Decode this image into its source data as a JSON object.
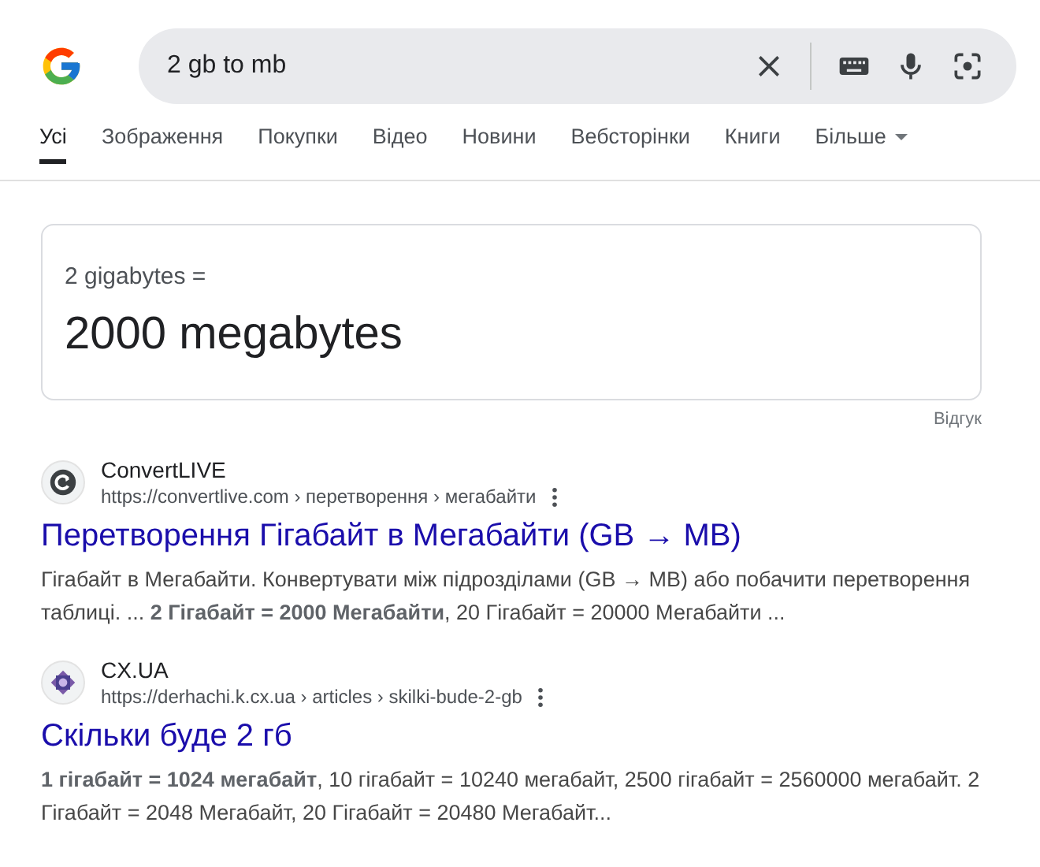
{
  "search": {
    "value": "2 gb to mb"
  },
  "tabs": [
    {
      "label": "Усі",
      "selected": true,
      "kind": "link"
    },
    {
      "label": "Зображення",
      "selected": false,
      "kind": "link"
    },
    {
      "label": "Покупки",
      "selected": false,
      "kind": "link"
    },
    {
      "label": "Відео",
      "selected": false,
      "kind": "link"
    },
    {
      "label": "Новини",
      "selected": false,
      "kind": "link"
    },
    {
      "label": "Вебсторінки",
      "selected": false,
      "kind": "link"
    },
    {
      "label": "Книги",
      "selected": false,
      "kind": "link"
    },
    {
      "label": "Більше",
      "selected": false,
      "kind": "dropdown"
    }
  ],
  "answer": {
    "question": "2 gigabytes =",
    "result": "2000 megabytes",
    "feedback": "Відгук"
  },
  "results": [
    {
      "site": "ConvertLIVE",
      "url": "https://convertlive.com › перетворення › мегабайти",
      "title": "Перетворення Гігабайт в Мегабайти (GB → MB)",
      "snippet": "Гігабайт в Мегабайти. Конвертувати між підрозділами (GB → MB) або побачити перетворення таблиці. ... **2 Гігабайт = 2000 Мегабайти**, 20 Гігабайт = 20000 Мегабайти ..."
    },
    {
      "site": "CX.UA",
      "url": "https://derhachi.k.cx.ua › articles › skilki-bude-2-gb",
      "title": "Скільки буде 2 гб",
      "snippet": "**1 гігабайт = 1024 мегабайт**, 10 гігабайт = 10240 мегабайт, 2500 гігабайт = 2560000 мегабайт. 2 Гігабайт = 2048 Мегабайт, 20 Гігабайт = 20480 Мегабайт..."
    }
  ]
}
